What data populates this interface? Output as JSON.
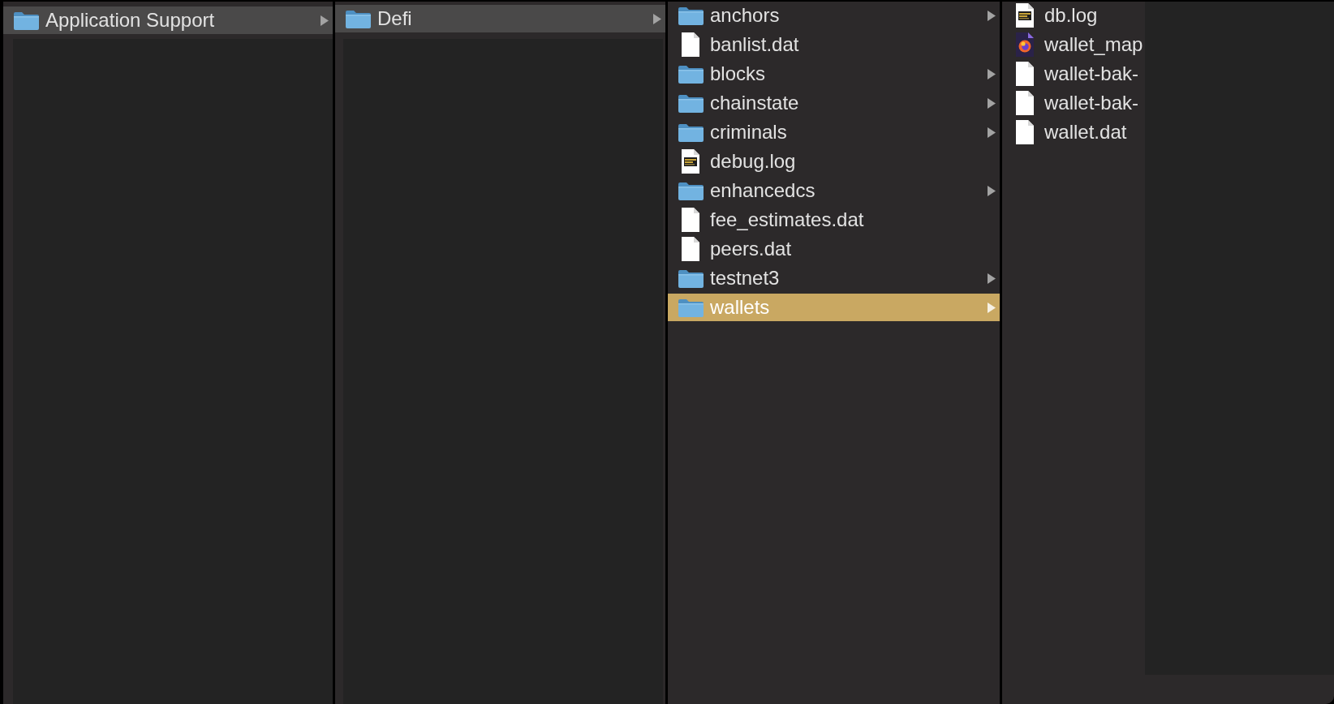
{
  "columns": [
    {
      "focused": false,
      "items": [
        {
          "name": "Application Support",
          "kind": "folder",
          "selected": true
        }
      ]
    },
    {
      "focused": false,
      "items": [
        {
          "name": "Defi",
          "kind": "folder",
          "selected": true
        }
      ]
    },
    {
      "focused": true,
      "items": [
        {
          "name": "anchors",
          "kind": "folder",
          "selected": false
        },
        {
          "name": "banlist.dat",
          "kind": "document",
          "selected": false
        },
        {
          "name": "blocks",
          "kind": "folder",
          "selected": false
        },
        {
          "name": "chainstate",
          "kind": "folder",
          "selected": false
        },
        {
          "name": "criminals",
          "kind": "folder",
          "selected": false
        },
        {
          "name": "debug.log",
          "kind": "log",
          "selected": false
        },
        {
          "name": "enhancedcs",
          "kind": "folder",
          "selected": false
        },
        {
          "name": "fee_estimates.dat",
          "kind": "document",
          "selected": false
        },
        {
          "name": "peers.dat",
          "kind": "document",
          "selected": false
        },
        {
          "name": "testnet3",
          "kind": "folder",
          "selected": false
        },
        {
          "name": "wallets",
          "kind": "folder",
          "selected": true
        }
      ]
    },
    {
      "items": [
        {
          "name": "db.log",
          "kind": "log",
          "selected": false
        },
        {
          "name": "wallet_map",
          "kind": "app_document",
          "selected": false
        },
        {
          "name": "wallet-bak-",
          "kind": "document",
          "selected": false
        },
        {
          "name": "wallet-bak-",
          "kind": "document",
          "selected": false
        },
        {
          "name": "wallet.dat",
          "kind": "document",
          "selected": false
        }
      ]
    }
  ]
}
